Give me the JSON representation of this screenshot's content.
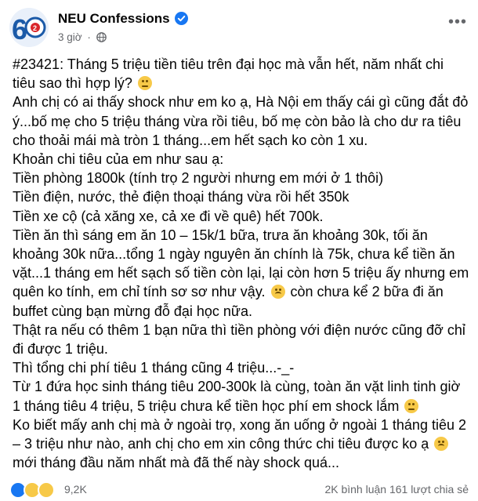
{
  "post": {
    "page_name": "NEU Confessions",
    "time": "3 giờ",
    "separator": "·",
    "body": [
      "#23421: Tháng 5 triệu tiền tiêu trên đại học mà vẫn hết, năm nhất chi tiêu sao thì hợp lý?",
      "Anh chị có ai thấy shock như em ko ạ, Hà Nội em thấy cái gì cũng đắt đỏ ý...bố mẹ cho 5 triệu tháng vừa rồi tiêu, bố mẹ còn bảo là cho dư ra tiêu cho thoải mái mà tròn 1 tháng...em hết sạch ko còn 1 xu.",
      "Khoản chi tiêu của em như sau ạ:",
      "Tiền phòng 1800k (tính trọ 2 người nhưng em mới ở 1 thôi)",
      "Tiền điện, nước, thẻ điện thoại tháng vừa rồi hết 350k",
      "Tiền xe cộ (cả xăng xe, cả xe đi về quê) hết 700k.",
      "Tiền ăn thì sáng em ăn 10 – 15k/1 bữa, trưa ăn khoảng 30k, tối ăn khoảng 30k nữa...tổng 1 ngày nguyên ăn chính là 75k, chưa kể tiền ăn vặt...1 tháng em hết sạch số tiền còn lại, lại còn hơn 5 triệu ấy nhưng em quên ko tính, em chỉ tính sơ sơ như vậy.",
      "còn chưa kể 2 bữa đi ăn buffet cùng bạn mừng đỗ đại học nữa.",
      "Thật ra nếu có thêm 1 bạn nữa thì tiền phòng với điện nước cũng đỡ chỉ đi được 1 triệu.",
      "Thì tổng chi phí tiêu 1 tháng cũng 4 triệu...-_-",
      "Từ 1 đứa học sinh tháng tiêu 200-300k là cùng, toàn ăn vặt linh tinh giờ 1 tháng tiêu 4 triệu, 5 triệu chưa kể tiền học phí em shock lắm",
      "Ko biết mấy anh chị mà ở ngoài trọ, xong ăn uống ở ngoài 1 tháng tiêu 2 – 3 triệu như nào, anh chị cho em xin công thức chi tiêu được ko ạ",
      "mới tháng đầu năm nhất mà đã thế này shock quá..."
    ]
  },
  "footer": {
    "reaction_count": "9,2K",
    "stats": "2K bình luận  161 lượt chia sẻ"
  },
  "colors": {
    "accent": "#1877f2",
    "muted": "#65676b",
    "text": "#050505"
  }
}
